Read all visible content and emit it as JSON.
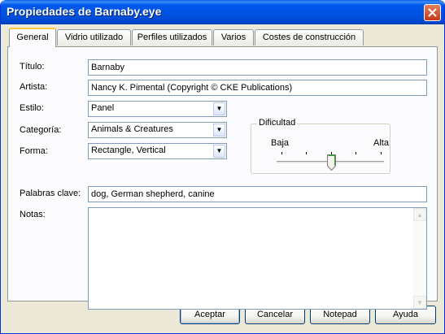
{
  "window": {
    "title": "Propiedades de Barnaby.eye"
  },
  "tabs": [
    {
      "label": "General",
      "active": true
    },
    {
      "label": "Vidrio utilizado",
      "active": false
    },
    {
      "label": "Perfiles utilizados",
      "active": false
    },
    {
      "label": "Varios",
      "active": false
    },
    {
      "label": "Costes de construcción",
      "active": false
    }
  ],
  "form": {
    "titulo_label": "Título:",
    "titulo_value": "Barnaby",
    "artista_label": "Artista:",
    "artista_value": "Nancy K. Pimental (Copyright © CKE Publications)",
    "estilo_label": "Estilo:",
    "estilo_value": "Panel",
    "categoria_label": "Categoría:",
    "categoria_value": "Animals & Creatures",
    "forma_label": "Forma:",
    "forma_value": "Rectangle, Vertical",
    "palabras_label": "Palabras clave:",
    "palabras_value": "dog, German shepherd, canine",
    "notas_label": "Notas:",
    "notas_value": ""
  },
  "dificultad": {
    "label": "Dificultad",
    "low_label": "Baja",
    "high_label": "Alta",
    "level_fraction": 0.5,
    "tick_count": 5
  },
  "buttons": {
    "accept": "Aceptar",
    "cancel": "Cancelar",
    "notepad": "Notepad",
    "help": "Ayuda"
  },
  "colors": {
    "titlebar": "#0054e3",
    "face": "#ece9d8",
    "panel": "#fcfcfe",
    "active_tab_accent": "#ffc83c"
  }
}
